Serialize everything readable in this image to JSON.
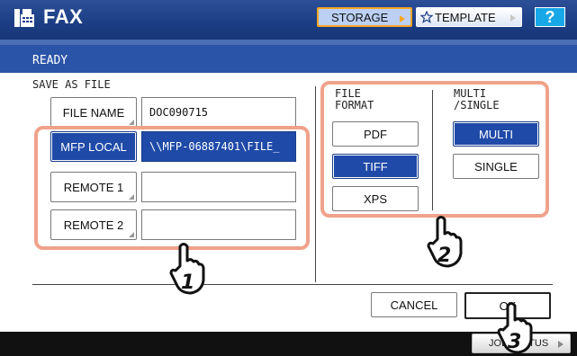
{
  "header": {
    "title": "FAX",
    "storage_label": "STORAGE",
    "template_label": "TEMPLATE",
    "help_label": "?"
  },
  "status": "READY",
  "section_title": "SAVE AS FILE",
  "file_name": {
    "button_label": "FILE NAME",
    "value": "DOC090715"
  },
  "destinations": [
    {
      "button_label": "MFP LOCAL",
      "value": "\\\\MFP-06887401\\FILE_",
      "selected": true
    },
    {
      "button_label": "REMOTE 1",
      "value": "",
      "selected": false
    },
    {
      "button_label": "REMOTE 2",
      "value": "",
      "selected": false
    }
  ],
  "file_format": {
    "label_line1": "FILE",
    "label_line2": "FORMAT",
    "options": [
      {
        "label": "PDF",
        "selected": false
      },
      {
        "label": "TIFF",
        "selected": true
      },
      {
        "label": "XPS",
        "selected": false
      }
    ]
  },
  "multi_single": {
    "label_line1": "MULTI",
    "label_line2": "/SINGLE",
    "options": [
      {
        "label": "MULTI",
        "selected": true
      },
      {
        "label": "SINGLE",
        "selected": false
      }
    ]
  },
  "actions": {
    "cancel_label": "CANCEL",
    "ok_label": "OK"
  },
  "job_status_label": "JOB STATUS",
  "callouts": [
    "1",
    "2",
    "3"
  ],
  "colors": {
    "header": "#1d3f86",
    "status_bar": "#2a54a8",
    "selected": "#1f4aa8",
    "highlight": "#f0a28a",
    "storage_border": "#f5a623",
    "help": "#18a8e8"
  }
}
